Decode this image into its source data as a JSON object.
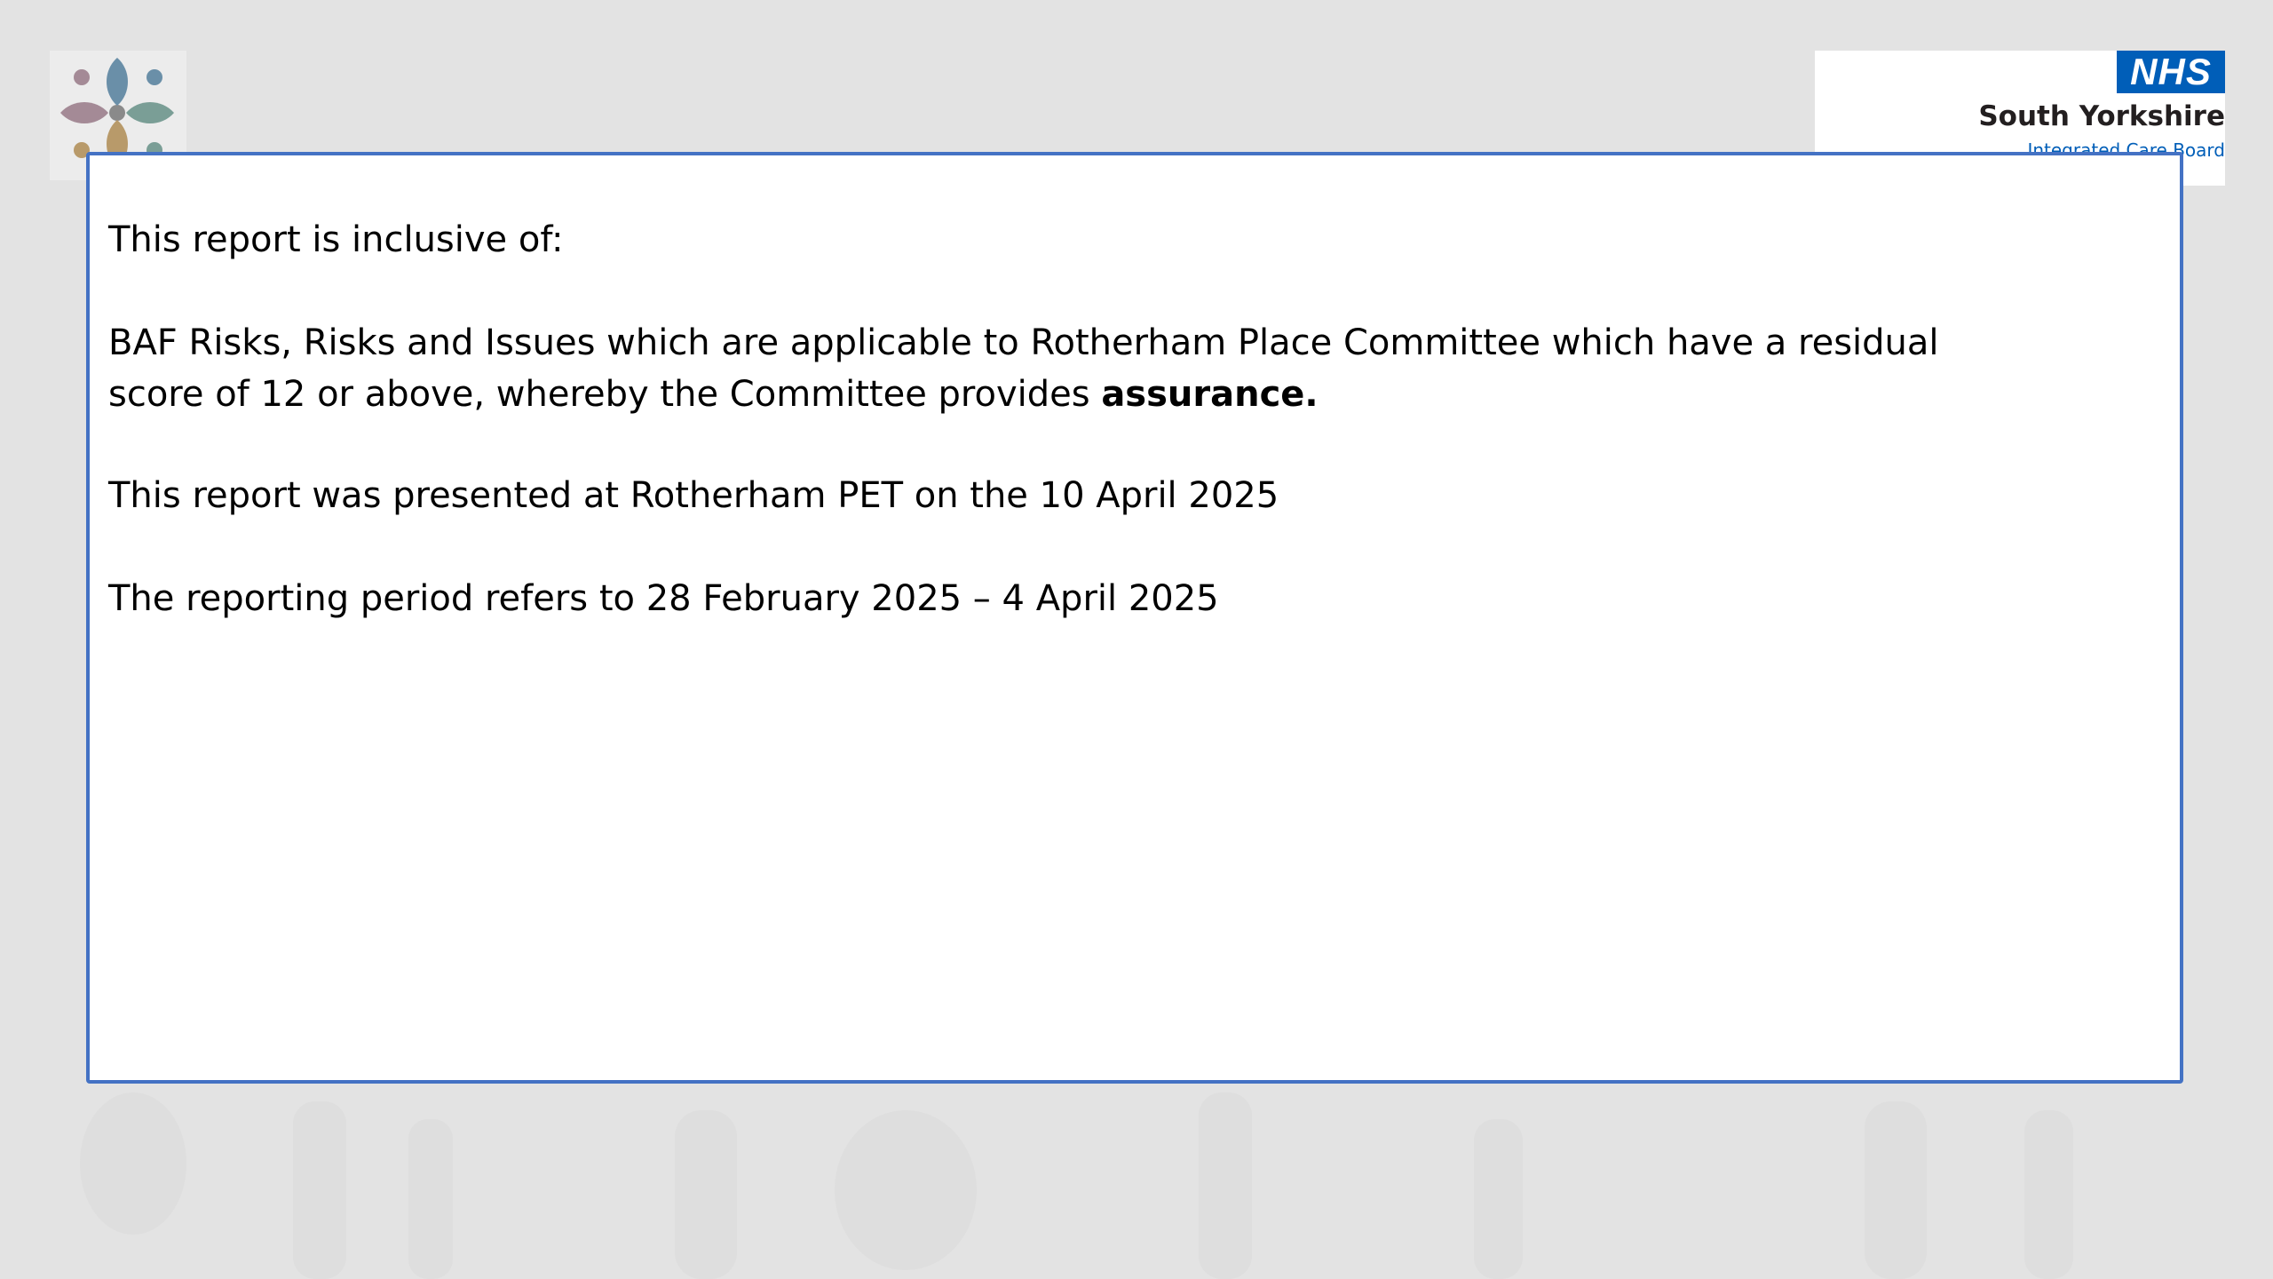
{
  "header": {
    "left_logo_icon": "partnership-flower-logo",
    "nhs_badge": "NHS",
    "org_name": "South Yorkshire",
    "org_subtitle": "Integrated Care Board"
  },
  "content": {
    "intro": "This report is inclusive of:",
    "scope_text": "BAF Risks, Risks and Issues which are applicable to Rotherham Place Committee which have a residual score of 12 or above, whereby the Committee provides ",
    "scope_emphasis": "assurance.",
    "presented": "This report was presented at Rotherham PET on the 10 April 2025",
    "period": "The reporting period refers to 28 February 2025 – 4 April 2025"
  },
  "colors": {
    "background": "#e3e3e3",
    "box_border": "#4472c4",
    "nhs_blue": "#005eb8"
  }
}
